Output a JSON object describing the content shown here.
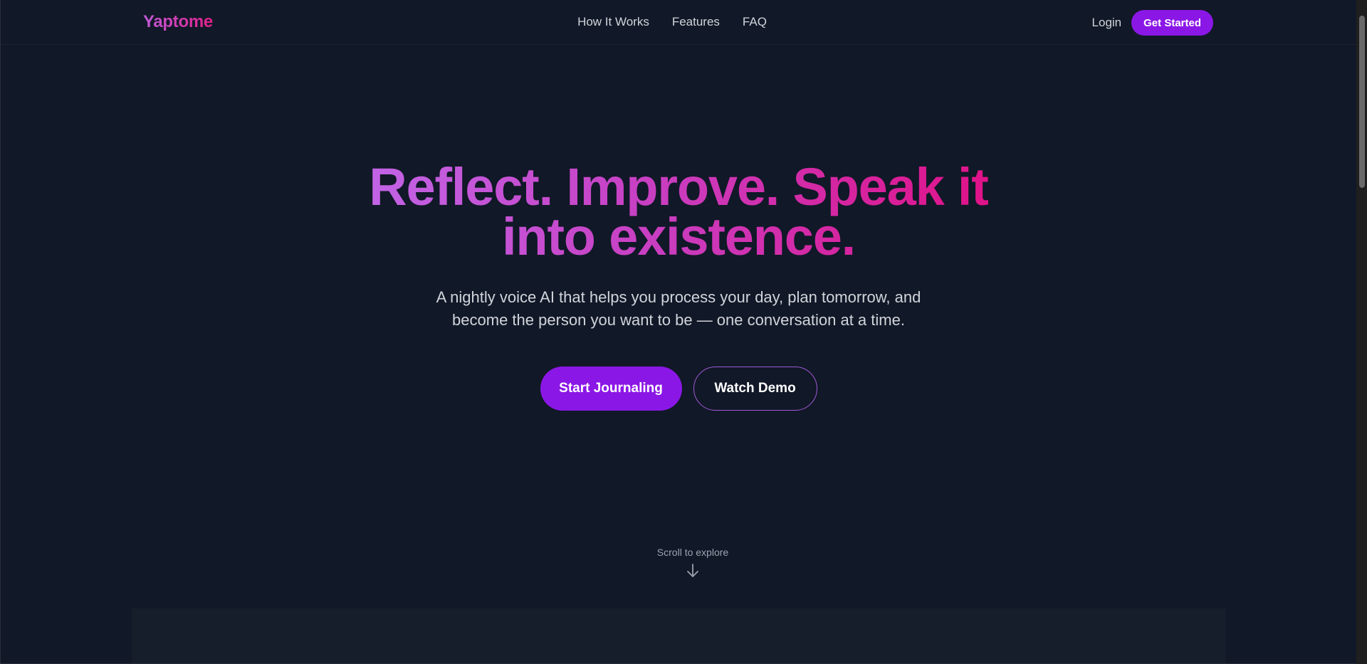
{
  "brand": {
    "logo_text": "Yaptome"
  },
  "nav": {
    "links": [
      "How It Works",
      "Features",
      "FAQ"
    ],
    "login_label": "Login",
    "get_started_label": "Get Started"
  },
  "hero": {
    "title": "Reflect. Improve. Speak it into existence.",
    "subtitle": "A nightly voice AI that helps you process your day, plan tomorrow, and become the person you want to be — one conversation at a time.",
    "primary_cta": "Start Journaling",
    "secondary_cta": "Watch Demo"
  },
  "scroll": {
    "label": "Scroll to explore",
    "icon": "arrow-down-icon"
  },
  "colors": {
    "background": "#111827",
    "accent": "#8b17e6",
    "gradient_start": "#c264e6",
    "gradient_end": "#e01288"
  }
}
